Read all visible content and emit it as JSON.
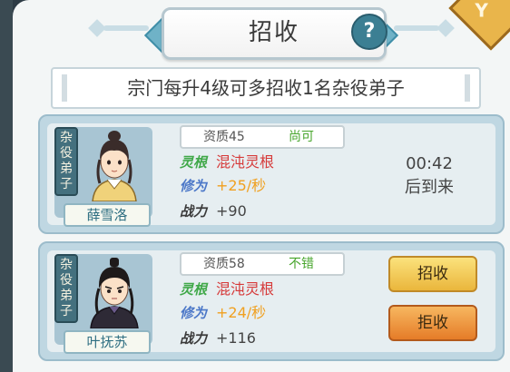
{
  "header": {
    "title": "招收",
    "help_label": "?",
    "corner_badge": "Y"
  },
  "info": {
    "text": "宗门每升4级可多招收1名杂役弟子"
  },
  "cards": [
    {
      "role_tag": [
        "杂",
        "役",
        "弟",
        "子"
      ],
      "name": "薛雪洛",
      "aptitude": "资质45",
      "grade": "尚可",
      "root_label": "灵根",
      "root_value": "混沌灵根",
      "cult_label": "修为",
      "cult_value": "+25/秒",
      "power_label": "战力",
      "power_value": "+90",
      "timer": "00:42",
      "timer_note": "后到来"
    },
    {
      "role_tag": [
        "杂",
        "役",
        "弟",
        "子"
      ],
      "name": "叶抚苏",
      "aptitude": "资质58",
      "grade": "不错",
      "root_label": "灵根",
      "root_value": "混沌灵根",
      "cult_label": "修为",
      "cult_value": "+24/秒",
      "power_label": "战力",
      "power_value": "+116",
      "recruit_label": "招收",
      "reject_label": "拒收"
    }
  ],
  "colors": {
    "grade_text": "#47a52c",
    "root_value": "#d63a3a",
    "cult_value": "#f0a020",
    "recruit_button": "#eab63c",
    "reject_button": "#e57c28"
  }
}
